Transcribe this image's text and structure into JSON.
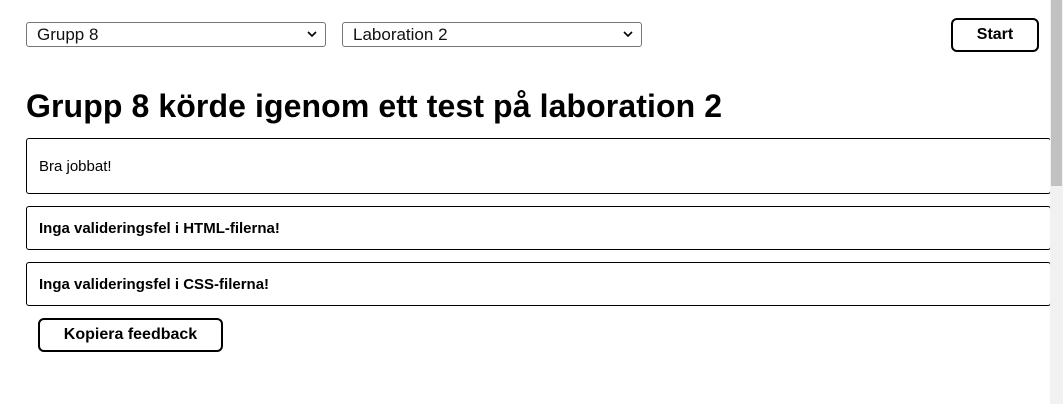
{
  "controls": {
    "group_select": {
      "value": "Grupp 8"
    },
    "lab_select": {
      "value": "Laboration 2"
    },
    "start_label": "Start"
  },
  "heading": "Grupp 8 körde igenom ett test på laboration 2",
  "feedback": [
    {
      "text": "Bra jobbat!"
    },
    {
      "text": "Inga valideringsfel i HTML-filerna!"
    },
    {
      "text": "Inga valideringsfel i CSS-filerna!"
    }
  ],
  "copy_label": "Kopiera feedback"
}
